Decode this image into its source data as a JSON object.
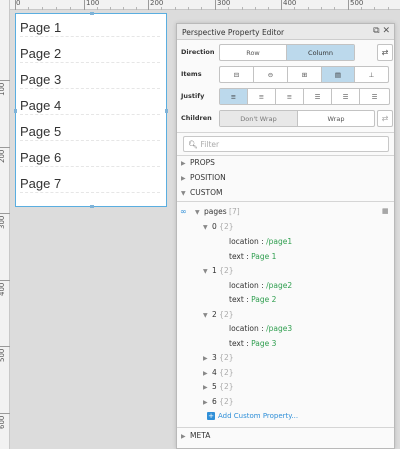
{
  "ruler": {
    "top_labels": [
      "0",
      "100",
      "200",
      "300",
      "400",
      "500"
    ],
    "left_labels": [
      "100",
      "200",
      "300",
      "400",
      "500",
      "600"
    ]
  },
  "view": {
    "items": [
      "Page 1",
      "Page 2",
      "Page 3",
      "Page 4",
      "Page 5",
      "Page 6",
      "Page 7"
    ]
  },
  "editor": {
    "title": "Perspective Property Editor",
    "direction": {
      "label": "Direction",
      "options": [
        "Row",
        "Column"
      ],
      "selected": "Column"
    },
    "items": {
      "label": "Items",
      "selected_index": 3
    },
    "justify": {
      "label": "Justify",
      "selected_index": 0
    },
    "children": {
      "label": "Children",
      "options": [
        "Don't Wrap",
        "Wrap"
      ],
      "selected": "Don't Wrap"
    },
    "filter_placeholder": "Filter",
    "sections": [
      "PROPS",
      "POSITION",
      "CUSTOM",
      "META"
    ],
    "custom": {
      "key": "pages",
      "count": "[7]",
      "entries": [
        {
          "index": "0",
          "count": "{2}",
          "location_key": "location",
          "location": "/page1",
          "text_key": "text",
          "text": "Page 1"
        },
        {
          "index": "1",
          "count": "{2}",
          "location_key": "location",
          "location": "/page2",
          "text_key": "text",
          "text": "Page 2"
        },
        {
          "index": "2",
          "count": "{2}",
          "location_key": "location",
          "location": "/page3",
          "text_key": "text",
          "text": "Page 3"
        }
      ],
      "collapsed": [
        {
          "index": "3",
          "count": "{2}"
        },
        {
          "index": "4",
          "count": "{2}"
        },
        {
          "index": "5",
          "count": "{2}"
        },
        {
          "index": "6",
          "count": "{2}"
        }
      ],
      "add_label": "Add Custom Property..."
    }
  },
  "colors": {
    "accent": "#2f8fd8",
    "value_green": "#2e9e4e",
    "selected": "#bcd9ec"
  }
}
